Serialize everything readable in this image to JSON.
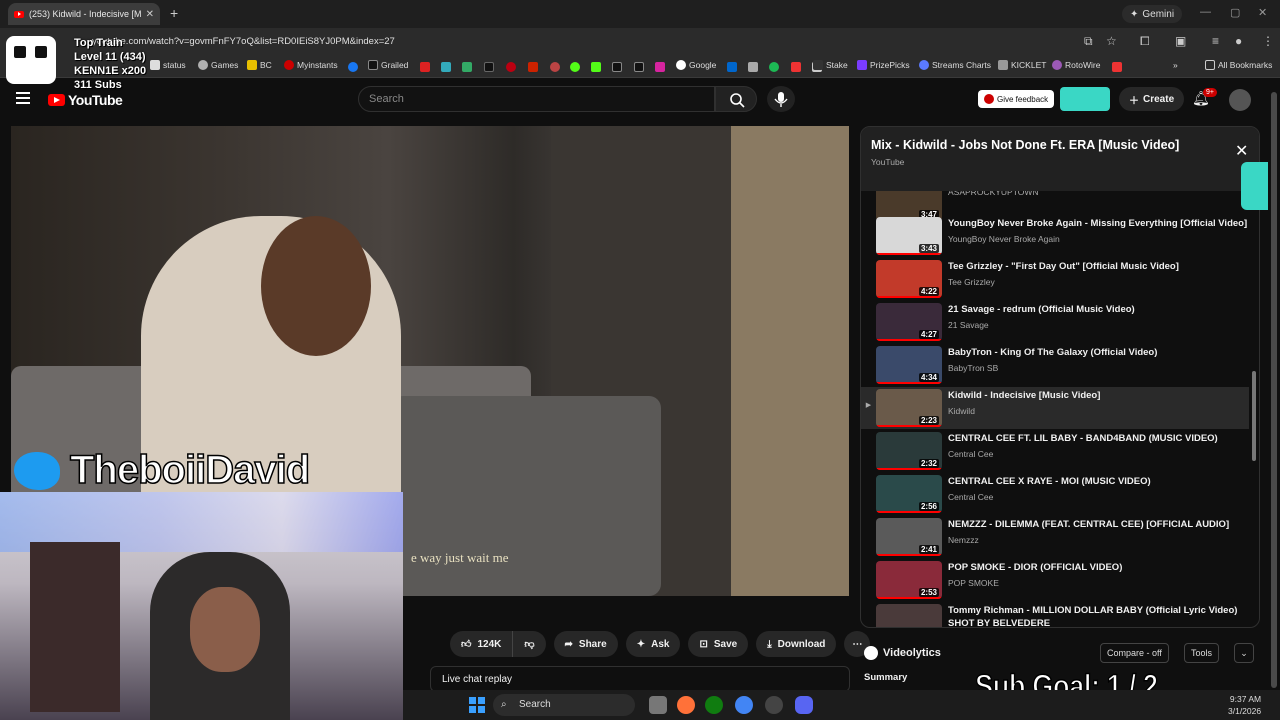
{
  "browser": {
    "tab_title": "(253) Kidwild - Indecisive [M",
    "url": "youtube.com/watch?v=govmFnFY7oQ&list=RD0IEiS8YJ0PM&index=27",
    "gemini_label": "Gemini",
    "bookmarks": [
      "status",
      "Games",
      "BC",
      "Myinstants",
      "Grailed",
      "Google",
      "Stake",
      "PrizePicks",
      "Streams Charts",
      "KICKLET",
      "RotoWire"
    ],
    "all_bookmarks_label": "All Bookmarks"
  },
  "overlay": {
    "train_title": "Top Train",
    "train_level": "Level 11  (434)",
    "train_user": "KENN1E x200",
    "subs": "311 Subs",
    "twitter_handle": "TheboiiDavid",
    "sub_goal": "Sub Goal:  1 / 2"
  },
  "youtube": {
    "logo_text": "YouTube",
    "search_placeholder": "Search",
    "feedback_label": "Give feedback",
    "create_label": "Create",
    "notif_badge": "9+"
  },
  "video": {
    "caption": "e way just wait me"
  },
  "actions": {
    "likes": "124K",
    "share": "Share",
    "ask": "Ask",
    "save": "Save",
    "download": "Download",
    "live_chat": "Live chat replay"
  },
  "playlist": {
    "title": "Mix - Kidwild - Jobs Not Done Ft. ERA [Music Video]",
    "subtitle": "YouTube",
    "items": [
      {
        "title": "",
        "channel": "ASAPROCKYUPTOWN",
        "duration": "3:47",
        "color": "#4a3a2a"
      },
      {
        "title": "YoungBoy Never Broke Again - Missing Everything [Official Video]",
        "channel": "YoungBoy Never Broke Again",
        "duration": "3:43",
        "color": "#d8d8d8"
      },
      {
        "title": "Tee Grizzley - \"First Day Out\" [Official Music Video]",
        "channel": "Tee Grizzley",
        "duration": "4:22",
        "color": "#c23a2a"
      },
      {
        "title": "21 Savage - redrum (Official Music Video)",
        "channel": "21 Savage",
        "duration": "4:27",
        "color": "#3a2a3a"
      },
      {
        "title": "BabyTron - King Of The Galaxy (Official Video)",
        "channel": "BabyTron SB",
        "duration": "4:34",
        "color": "#3a4a6a"
      },
      {
        "title": "Kidwild - Indecisive [Music Video]",
        "channel": "Kidwild",
        "duration": "2:23",
        "color": "#6a5a4a",
        "active": true
      },
      {
        "title": "CENTRAL CEE FT. LIL BABY - BAND4BAND (MUSIC VIDEO)",
        "channel": "Central Cee",
        "duration": "2:32",
        "color": "#2a3a3a"
      },
      {
        "title": "CENTRAL CEE X RAYE - MOI (MUSIC VIDEO)",
        "channel": "Central Cee",
        "duration": "2:56",
        "color": "#2a4a4a"
      },
      {
        "title": "NEMZZZ - DILEMMA (FEAT. CENTRAL CEE) [OFFICIAL AUDIO]",
        "channel": "Nemzzz",
        "duration": "2:41",
        "color": "#5a5a5a"
      },
      {
        "title": "POP SMOKE - DIOR (OFFICIAL VIDEO)",
        "channel": "POP SMOKE",
        "duration": "2:53",
        "color": "#8a2a3a"
      },
      {
        "title": "Tommy Richman - MILLION DOLLAR BABY (Official Lyric Video) SHOT BY BELVEDERE",
        "channel": "",
        "duration": "",
        "color": "#4a3a3a"
      }
    ]
  },
  "videolytics": {
    "title": "Videolytics",
    "compare_label": "Compare - off",
    "tools_label": "Tools",
    "summary_label": "Summary"
  },
  "taskbar": {
    "search_label": "Search",
    "time": "9:37 AM",
    "date": "3/1/2026"
  }
}
